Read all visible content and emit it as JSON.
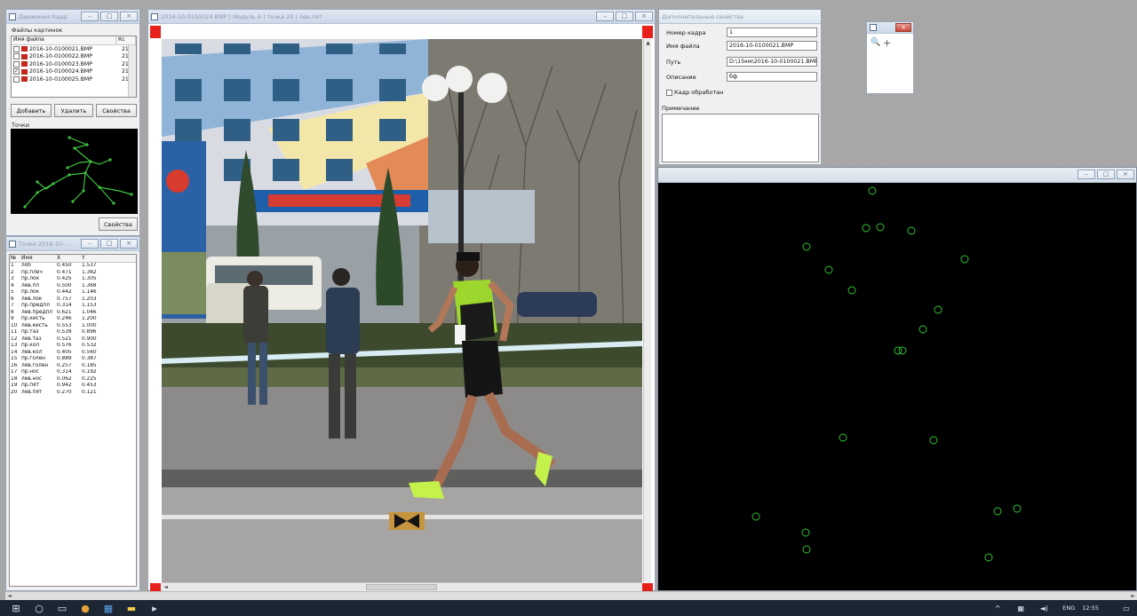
{
  "files_window": {
    "title": "Движения Кадр",
    "group_label": "Файлы картинок",
    "columns": [
      "Имя файла",
      "Кс"
    ],
    "files": [
      {
        "name": "2016-10-0100021.BMP",
        "frame": "21",
        "checked": false
      },
      {
        "name": "2016-10-0100022.BMP",
        "frame": "21",
        "checked": false
      },
      {
        "name": "2016-10-0100023.BMP",
        "frame": "21",
        "checked": false
      },
      {
        "name": "2016-10-0100024.BMP",
        "frame": "21",
        "checked": true
      },
      {
        "name": "2016-10-0100025.BMP",
        "frame": "21",
        "checked": false
      }
    ],
    "btn_add": "Добавить",
    "btn_delete": "Удалить",
    "btn_props": "Свойства",
    "points_label": "Точки",
    "btn_props2": "Свойства"
  },
  "points_window": {
    "title": "Точки 2016-10-...",
    "columns": [
      "№",
      "Имя",
      "X",
      "Y"
    ],
    "rows": [
      [
        "1",
        "лоб",
        "0.450",
        "1.537"
      ],
      [
        "2",
        "пр.плеч",
        "0.471",
        "1.382"
      ],
      [
        "3",
        "пр.лок",
        "0.425",
        "1.305"
      ],
      [
        "4",
        "лев.пл",
        "0.500",
        "1.368"
      ],
      [
        "5",
        "пр.лок",
        "0.442",
        "1.146"
      ],
      [
        "6",
        "лев.лок",
        "0.757",
        "1.203"
      ],
      [
        "7",
        "пр.предпл",
        "0.314",
        "1.153"
      ],
      [
        "8",
        "лев.предпл",
        "0.621",
        "1.046"
      ],
      [
        "9",
        "пр.кисть",
        "0.246",
        "1.200"
      ],
      [
        "10",
        "лев.кисть",
        "0.553",
        "1.000"
      ],
      [
        "11",
        "пр.таз",
        "0.539",
        "0.896"
      ],
      [
        "12",
        "лев.таз",
        "0.521",
        "0.900"
      ],
      [
        "13",
        "пр.кол",
        "0.576",
        "0.532"
      ],
      [
        "14",
        "лев.кол",
        "0.405",
        "0.560"
      ],
      [
        "15",
        "пр.голен",
        "0.889",
        "0.387"
      ],
      [
        "16",
        "лев.голен",
        "0.257",
        "0.185"
      ],
      [
        "17",
        "пр.нос",
        "0.314",
        "0.192"
      ],
      [
        "18",
        "лев.нос",
        "0.062",
        "0.225"
      ],
      [
        "19",
        "пр.пят",
        "0.942",
        "0.453"
      ],
      [
        "20",
        "лев.пят",
        "0.270",
        "0.121"
      ]
    ]
  },
  "image_window": {
    "title": "2016-10-0100024.BMP | Модуль А | точка 20 | лев.пят"
  },
  "props_window": {
    "title": "Дополнительные свойства",
    "frame_label": "Номер кадра",
    "frame_value": "1",
    "filename_label": "Имя файла",
    "filename_value": "2016-10-0100021.BMP",
    "path_label": "Путь",
    "path_value": "D:\\15км\\2016-10-0100021.BMP",
    "desc_label": "Описание",
    "desc_value": "бф",
    "processed_label": "Кадр обработан",
    "notes_label": "Примечание"
  },
  "tool_window": {
    "title": ""
  },
  "taskbar": {
    "lang": "ENG",
    "time": "12:55"
  },
  "colors": {
    "points": "#33cc33",
    "marker": "#e8201a",
    "black_panel": "#000000"
  }
}
